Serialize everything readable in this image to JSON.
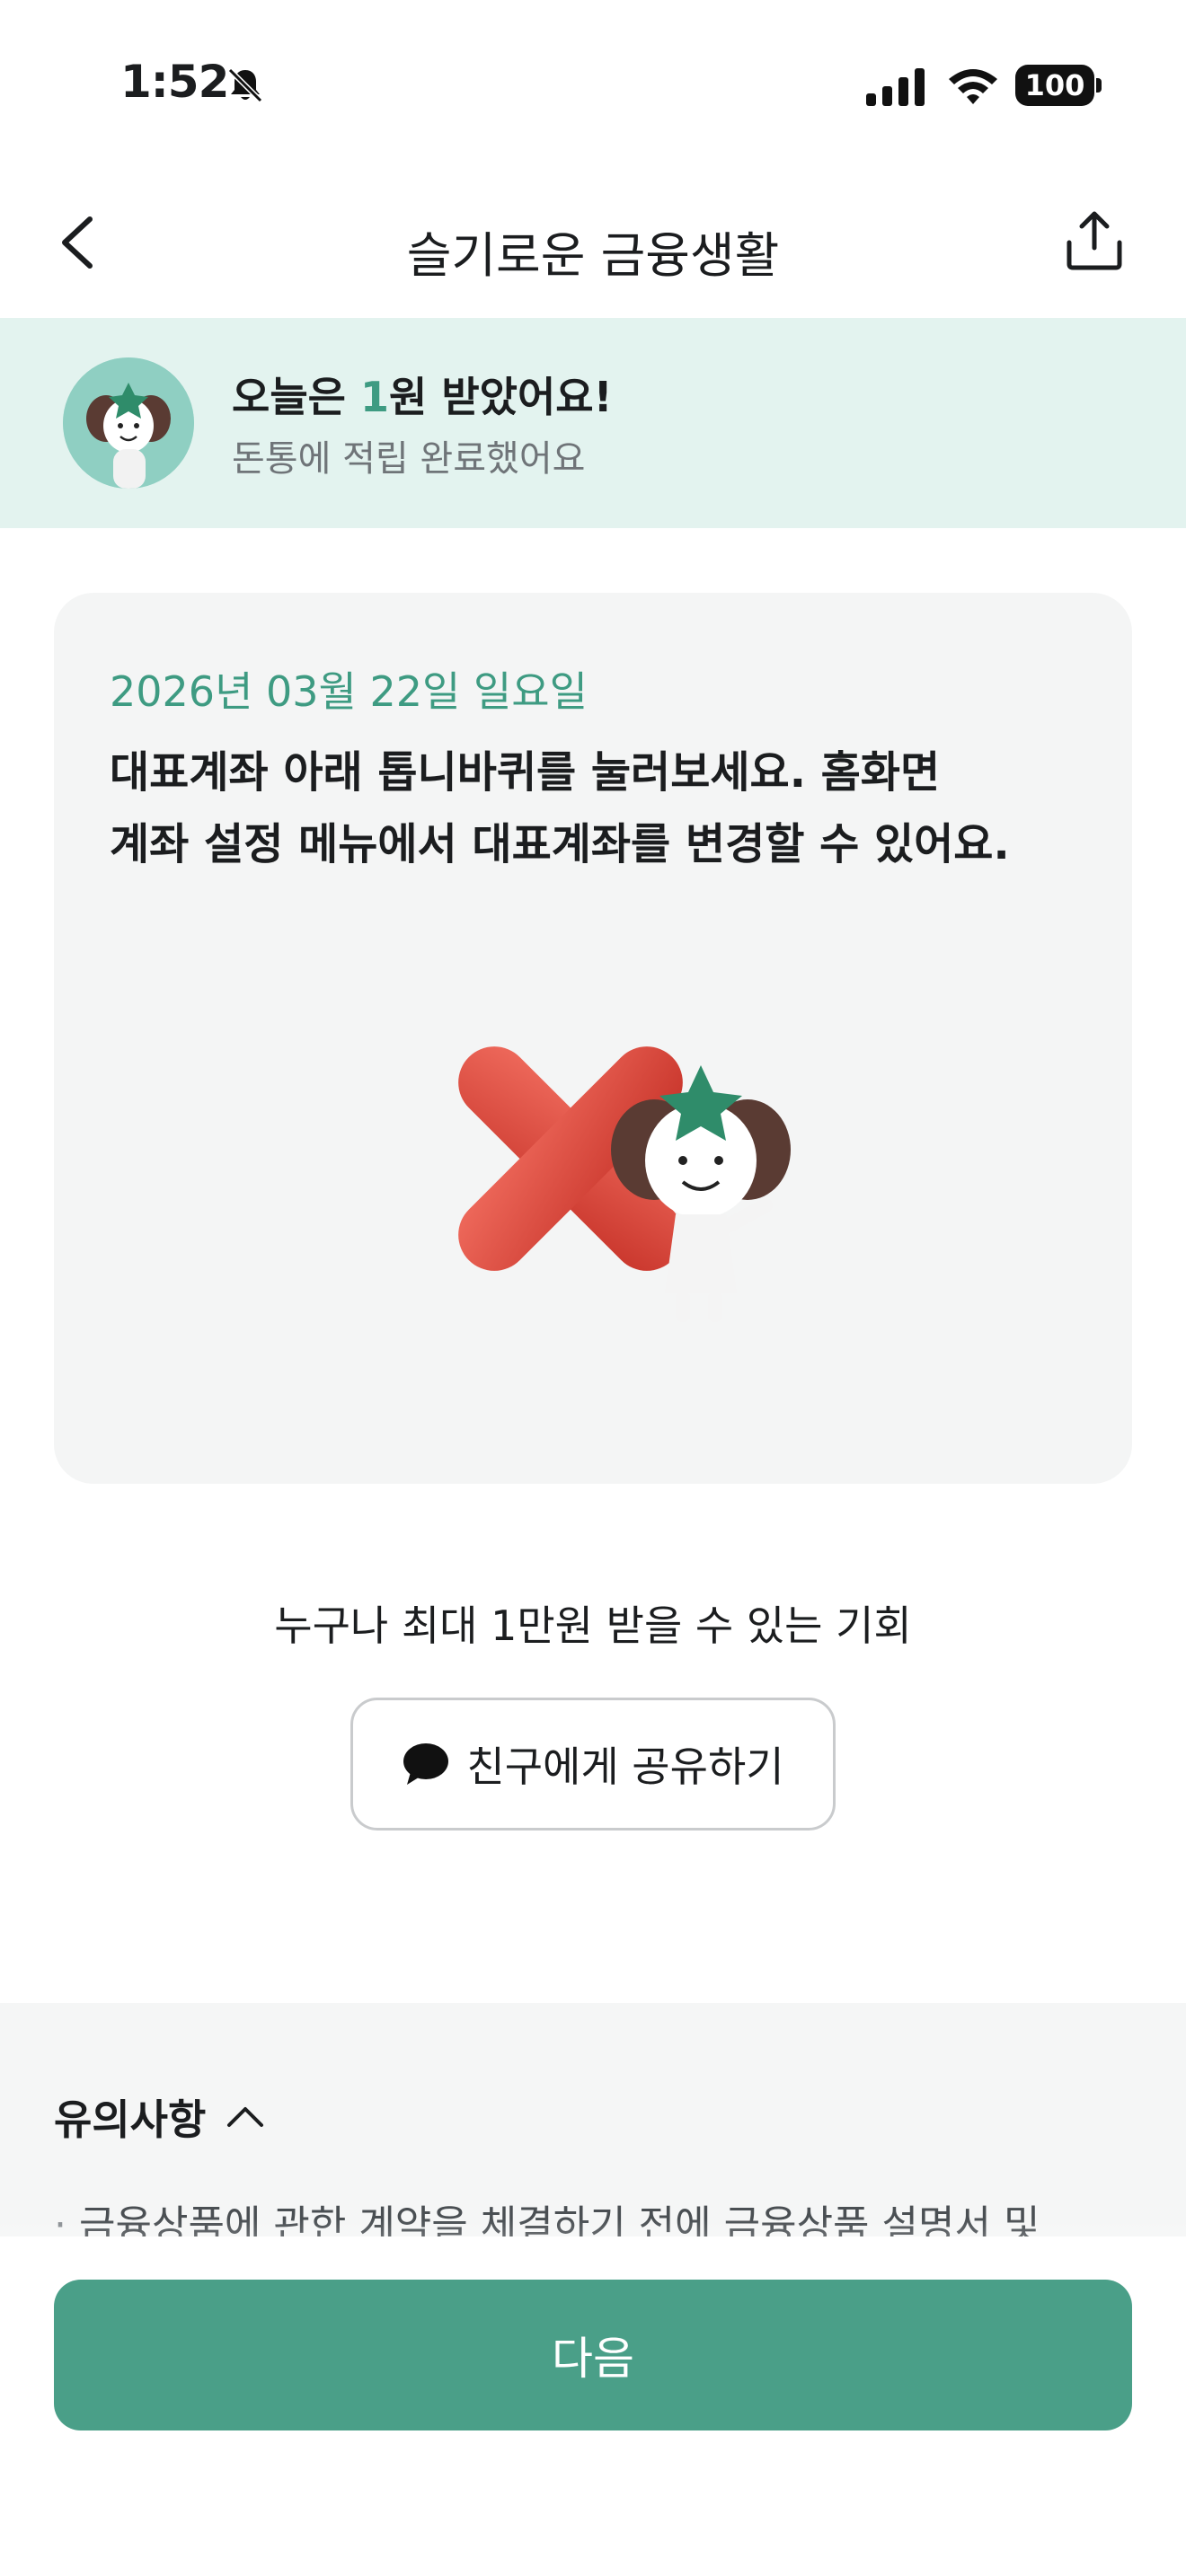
{
  "status_bar": {
    "time": "1:52",
    "battery": "100"
  },
  "nav": {
    "title": "슬기로운 금융생활"
  },
  "reward_banner": {
    "title_prefix": "오늘은 ",
    "title_amount": "1",
    "title_suffix": "원 받았어요!",
    "subtitle": "돈통에 적립 완료했어요"
  },
  "card": {
    "date": "2026년 03월 22일 일요일",
    "line1": "대표계좌 아래 톱니바퀴를 눌러보세요. 홈화면",
    "line2": "계좌 설정 메뉴에서 대표계좌를 변경할 수 있어요."
  },
  "share": {
    "caption": "누구나 최대 1만원 받을 수 있는 기회",
    "button_label": "친구에게 공유하기"
  },
  "notice": {
    "title": "유의사항",
    "items": [
      "금융상품에 관한 계약을 체결하기 전에 금융상품 설명서 및"
    ]
  },
  "bottom": {
    "next_label": "다음"
  },
  "colors": {
    "accent_green": "#3e9b82",
    "button_green": "#4a9f88",
    "banner_bg": "#e3f3ef",
    "card_bg": "#f4f5f5",
    "x_red": "#d8443a"
  }
}
